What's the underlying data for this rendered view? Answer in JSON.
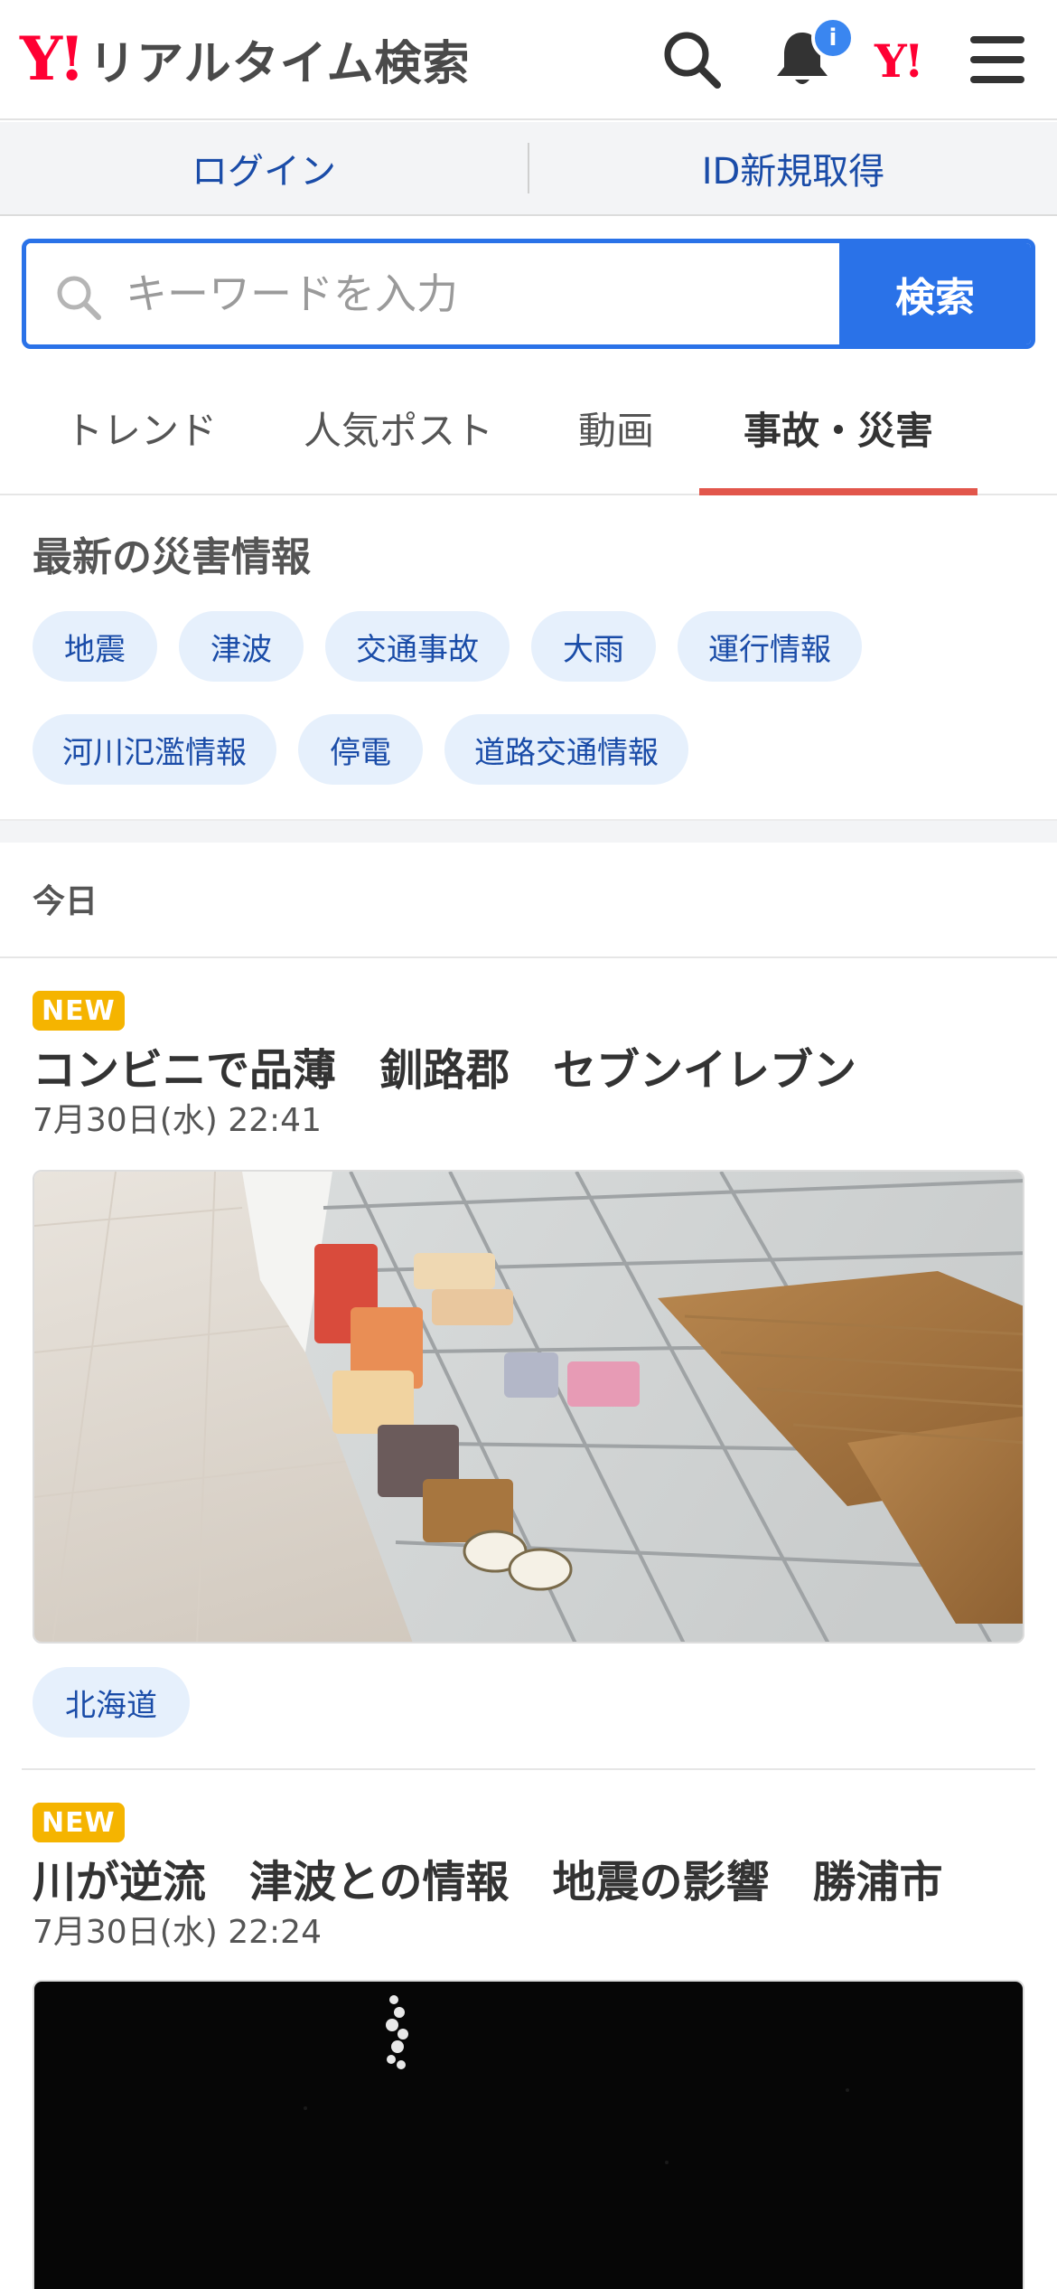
{
  "header": {
    "logo_mark": "Y!",
    "logo_text": "リアルタイム検索",
    "notification_badge": "i",
    "yjapan_mark": "Y!",
    "icons": [
      "search-icon",
      "bell-icon",
      "yahoo-japan-icon",
      "menu-icon"
    ]
  },
  "auth": {
    "login": "ログイン",
    "register": "ID新規取得"
  },
  "search": {
    "placeholder": "キーワードを入力",
    "value": "",
    "button": "検索"
  },
  "tabs": [
    {
      "label": "トレンド",
      "active": false
    },
    {
      "label": "人気ポスト",
      "active": false
    },
    {
      "label": "動画",
      "active": false
    },
    {
      "label": "事故・災害",
      "active": true
    }
  ],
  "disaster": {
    "title": "最新の災害情報",
    "chips": [
      "地震",
      "津波",
      "交通事故",
      "大雨",
      "運行情報",
      "河川氾濫情報",
      "停電",
      "道路交通情報"
    ]
  },
  "feed": {
    "day_label": "今日",
    "articles": [
      {
        "badge": "NEW",
        "title": "コンビニで品薄　釧路郡　セブンイレブン",
        "time": "7月30日(水) 22:41",
        "image": "convenience-store-empty-shelves",
        "tag": "北海道"
      },
      {
        "badge": "NEW",
        "title": "川が逆流　津波との情報　地震の影響　勝浦市",
        "time": "7月30日(水) 22:24",
        "image": "dark-night-video-frame"
      }
    ]
  },
  "colors": {
    "brand_red": "#ff0033",
    "accent_blue": "#2a72e8",
    "link_blue": "#1a4ca8",
    "chip_bg": "#e6f0fc",
    "tab_underline": "#e2564b",
    "new_badge": "#f5b400"
  }
}
